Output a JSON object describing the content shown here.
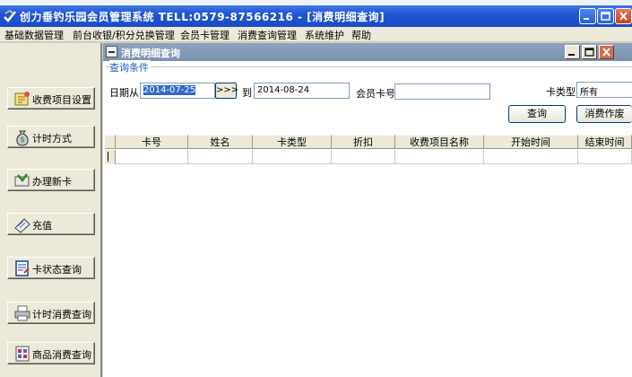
{
  "window": {
    "title": "创力垂钓乐园会员管理系统  TELL:0579-87566216  - [消费明细查询]"
  },
  "menu": [
    "基础数据管理",
    "前台收银/积分兑换管理",
    "会员卡管理",
    "消费查询管理",
    "系统维护",
    "帮助"
  ],
  "sidebar": {
    "items": [
      {
        "label": "收费项目设置",
        "icon": "settings-icon"
      },
      {
        "label": "计时方式",
        "icon": "money-bag-icon"
      },
      {
        "label": "办理新卡",
        "icon": "new-card-icon"
      },
      {
        "label": "充值",
        "icon": "recharge-icon"
      },
      {
        "label": "卡状态查询",
        "icon": "card-status-icon"
      },
      {
        "label": "计时消费查询",
        "icon": "printer-icon"
      },
      {
        "label": "商品消费查询",
        "icon": "goods-icon"
      }
    ]
  },
  "child_window": {
    "title": "消费明细查询"
  },
  "query": {
    "group_label": "查询条件",
    "date_from_label": "日期从",
    "date_from_value": "2014-07-25",
    "range_button_label": ">>>",
    "to_label": "到",
    "date_to_value": "2014-08-24",
    "card_no_label": "会员卡号",
    "card_no_value": "",
    "card_type_label": "卡类型",
    "card_type_value": "所有",
    "search_label": "查询",
    "void_label": "消费作废"
  },
  "table": {
    "columns": [
      "卡号",
      "姓名",
      "卡类型",
      "折扣",
      "收费项目名称",
      "开始时间",
      "结束时间"
    ],
    "rows": []
  }
}
